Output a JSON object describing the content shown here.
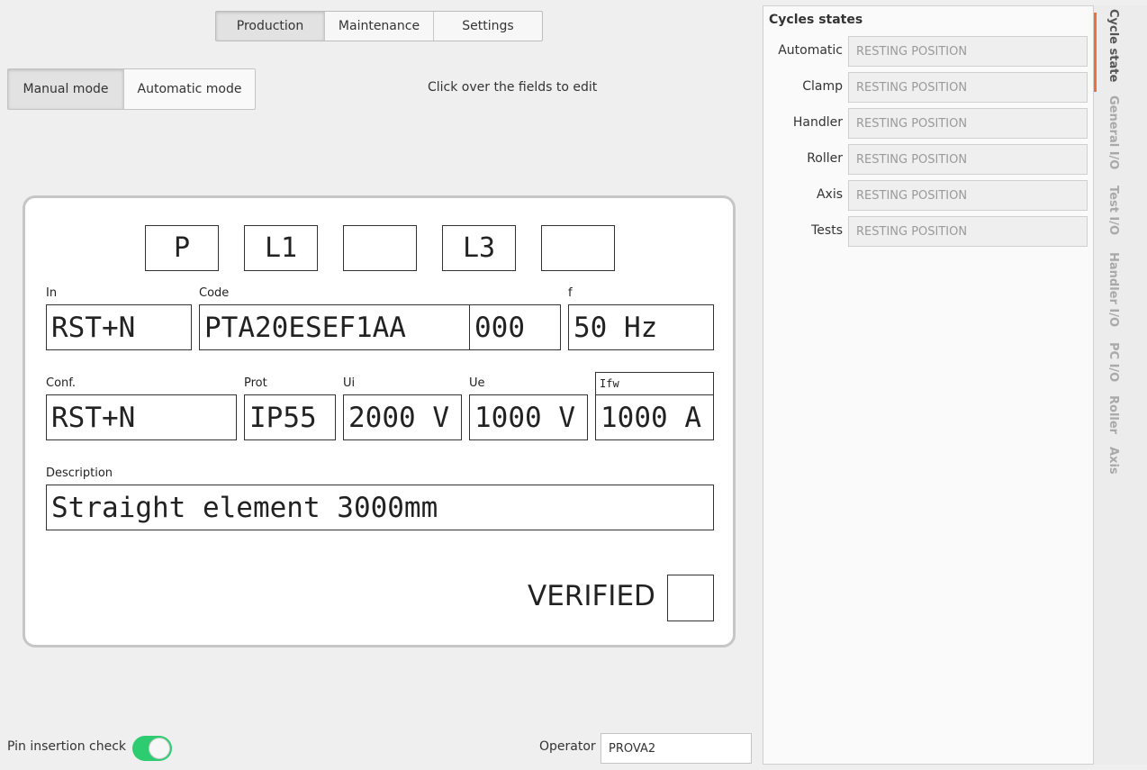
{
  "tabs": [
    "Production",
    "Maintenance",
    "Settings"
  ],
  "modes": [
    "Manual mode",
    "Automatic mode"
  ],
  "hint": "Click over the fields to edit",
  "plate": {
    "phases": [
      "P",
      "L1",
      "",
      "L3",
      ""
    ],
    "fields": {
      "in": {
        "label": "In",
        "value": "RST+N"
      },
      "code": {
        "label": "Code",
        "value": "PTA20ESEF1AA",
        "suffix": "000"
      },
      "f": {
        "label": "f",
        "value": "50 Hz"
      },
      "conf": {
        "label": "Conf.",
        "value": "RST+N"
      },
      "prot": {
        "label": "Prot",
        "value": "IP55"
      },
      "ui": {
        "label": "Ui",
        "value": "2000 V"
      },
      "ue": {
        "label": "Ue",
        "value": "1000 V"
      },
      "ifw": {
        "label": "Ifw",
        "value": "1000 A"
      },
      "description": {
        "label": "Description",
        "value": "Straight element 3000mm"
      }
    },
    "verified_label": "VERIFIED"
  },
  "bottom": {
    "pin_label": "Pin insertion check",
    "pin_enabled": true,
    "operator_label": "Operator",
    "operator_value": "PROVA2"
  },
  "cycles": {
    "title": "Cycles states",
    "rows": [
      {
        "label": "Automatic",
        "value": "RESTING POSITION"
      },
      {
        "label": "Clamp",
        "value": "RESTING POSITION"
      },
      {
        "label": "Handler",
        "value": "RESTING POSITION"
      },
      {
        "label": "Roller",
        "value": "RESTING POSITION"
      },
      {
        "label": "Axis",
        "value": "RESTING POSITION"
      },
      {
        "label": "Tests",
        "value": "RESTING POSITION"
      }
    ]
  },
  "side_tabs": [
    "Cycle state",
    "General I/O",
    "Test I/O",
    "Handler I/O",
    "PC I/O",
    "Roller",
    "Axis"
  ],
  "colors": {
    "accent": "#e8713c",
    "toggle_on": "#2ecc71"
  }
}
